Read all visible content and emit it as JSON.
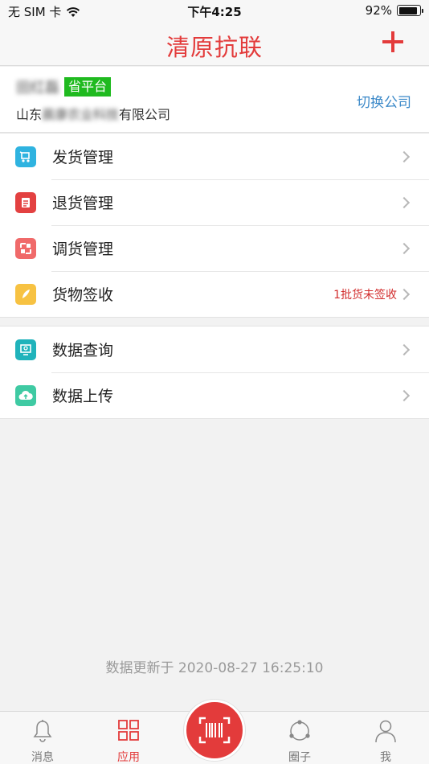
{
  "status_bar": {
    "carrier": "无 SIM 卡",
    "time": "下午4:25",
    "battery_text": "92%",
    "battery_level": 0.92
  },
  "nav": {
    "title": "清原抗联",
    "add_icon": "plus-icon"
  },
  "company": {
    "user_name": "田红磊",
    "level_badge": "省平台",
    "company_prefix": "山东",
    "company_hidden": "晨康农业科技",
    "company_suffix": "有限公司",
    "switch_label": "切换公司"
  },
  "menu_group_1": [
    {
      "label": "发货管理",
      "icon": "shipping-icon",
      "color": "#2fb3e0",
      "extra": ""
    },
    {
      "label": "退货管理",
      "icon": "return-doc-icon",
      "color": "#e34141",
      "extra": ""
    },
    {
      "label": "调货管理",
      "icon": "transfer-icon",
      "color": "#f06a6a",
      "extra": ""
    },
    {
      "label": "货物签收",
      "icon": "sign-pen-icon",
      "color": "#f7c242",
      "extra": "1批货未签收"
    }
  ],
  "menu_group_2": [
    {
      "label": "数据查询",
      "icon": "monitor-search-icon",
      "color": "#20b3bb",
      "extra": ""
    },
    {
      "label": "数据上传",
      "icon": "cloud-upload-icon",
      "color": "#3fcaa3",
      "extra": ""
    }
  ],
  "update_time": "数据更新于 2020-08-27 16:25:10",
  "tab_bar": {
    "messages": "消息",
    "apps": "应用",
    "circle": "圈子",
    "me": "我",
    "active": "apps"
  },
  "colors": {
    "brand_red": "#e33b3b",
    "link_blue": "#3a88c8",
    "badge_green": "#1fba1f"
  }
}
